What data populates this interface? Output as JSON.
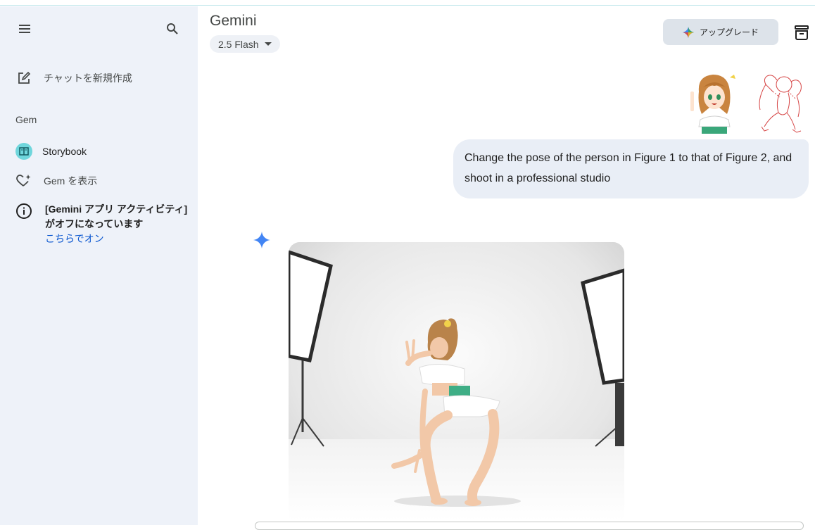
{
  "sidebar": {
    "new_chat_label": "チャットを新規作成",
    "gem_heading": "Gem",
    "storybook_label": "Storybook",
    "show_gem_label": "Gem を表示",
    "activity_notice": "[Gemini アプリ アクティビティ] がオフになっています",
    "activity_link": "こちらでオン"
  },
  "header": {
    "title": "Gemini",
    "model": "2.5 Flash",
    "upgrade_label": "アップグレード"
  },
  "chat": {
    "user_message": "Change the pose of the person in Figure 1 to that of Figure 2, and shoot in a professional studio"
  },
  "colors": {
    "sidebar_bg": "#eef2f9",
    "bubble_bg": "#e9eef6",
    "link": "#0b57d0",
    "spark": "#4285f4"
  }
}
